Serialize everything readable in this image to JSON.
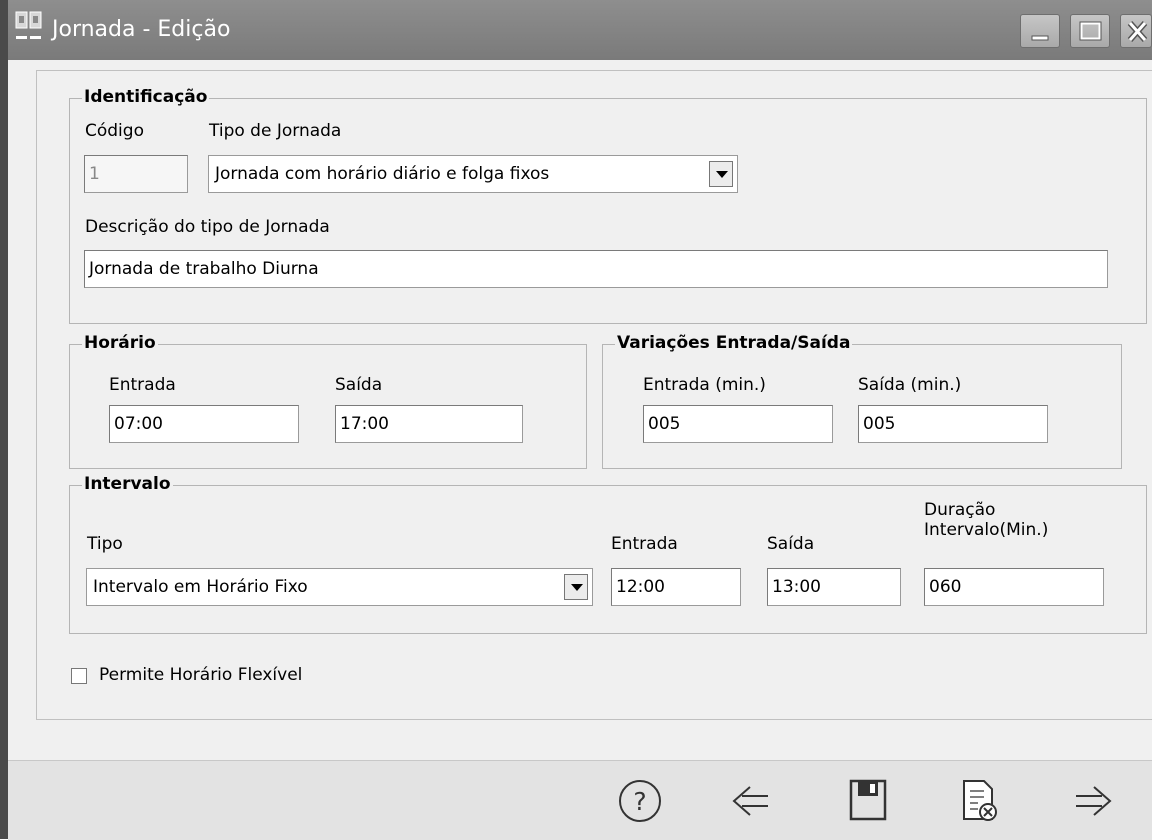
{
  "window": {
    "title": "Jornada - Edição"
  },
  "identificacao": {
    "title": "Identificação",
    "codigo_label": "Código",
    "codigo_value": "1",
    "tipo_label": "Tipo de Jornada",
    "tipo_value": "Jornada com horário diário e folga fixos",
    "descricao_label": "Descrição do tipo de Jornada",
    "descricao_value": "Jornada de trabalho Diurna"
  },
  "horario": {
    "title": "Horário",
    "entrada_label": "Entrada",
    "entrada_value": "07:00",
    "saida_label": "Saída",
    "saida_value": "17:00"
  },
  "variacoes": {
    "title": "Variações Entrada/Saída",
    "entrada_label": "Entrada (min.)",
    "entrada_value": "005",
    "saida_label": "Saída (min.)",
    "saida_value": "005"
  },
  "intervalo": {
    "title": "Intervalo",
    "tipo_label": "Tipo",
    "tipo_value": "Intervalo em Horário Fixo",
    "entrada_label": "Entrada",
    "entrada_value": "12:00",
    "saida_label": "Saída",
    "saida_value": "13:00",
    "duracao_label_1": "Duração",
    "duracao_label_2": "Intervalo(Min.)",
    "duracao_value": "060"
  },
  "flexivel": {
    "label": "Permite Horário Flexível",
    "checked": false
  },
  "footer": {
    "icons": [
      "help-icon",
      "back-arrow-icon",
      "save-icon",
      "cancel-document-icon",
      "forward-arrow-icon"
    ]
  },
  "colors": {
    "titlebar": "#858585",
    "panel": "#f0f0f0",
    "footer": "#e3e3e3"
  }
}
